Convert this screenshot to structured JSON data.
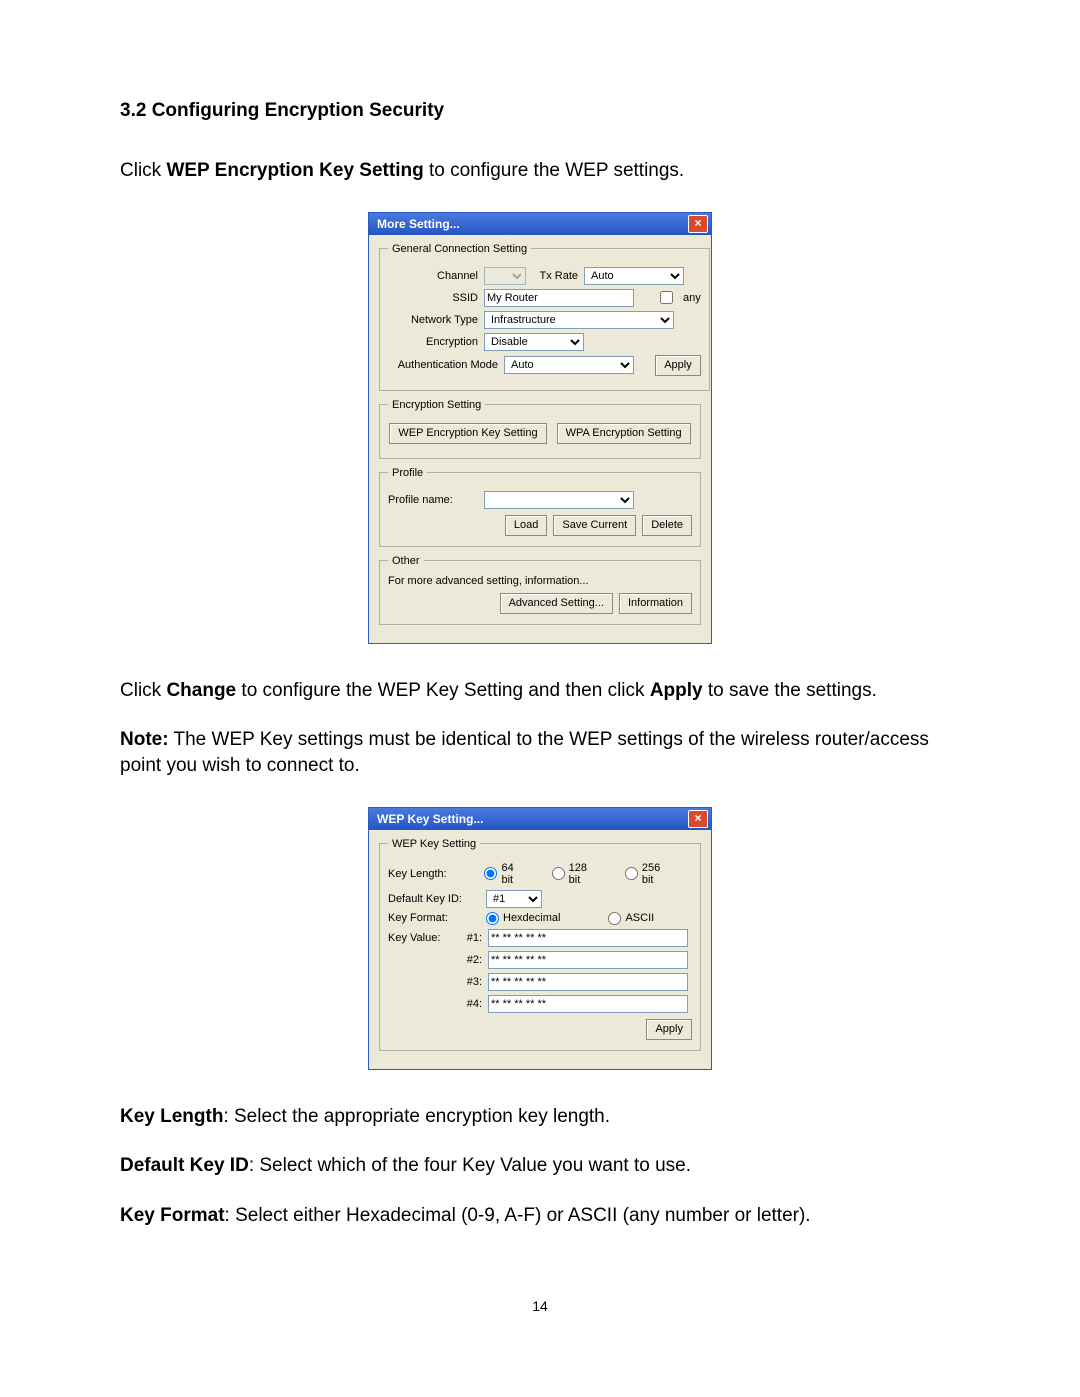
{
  "heading": "3.2 Configuring Encryption Security",
  "para1_pre": "Click ",
  "para1_bold": "WEP Encryption Key Setting",
  "para1_post": " to configure the WEP settings.",
  "dialog1": {
    "title": "More Setting...",
    "close_glyph": "×",
    "general_legend": "General Connection Setting",
    "channel_label": "Channel",
    "channel_value": "",
    "txrate_label": "Tx Rate",
    "txrate_value": "Auto",
    "ssid_label": "SSID",
    "ssid_value": "My Router",
    "any_label": "any",
    "network_type_label": "Network Type",
    "network_type_value": "Infrastructure",
    "encryption_label": "Encryption",
    "encryption_value": "Disable",
    "auth_label": "Authentication Mode",
    "auth_value": "Auto",
    "apply_label": "Apply",
    "enc_legend": "Encryption Setting",
    "wep_btn": "WEP Encryption Key Setting",
    "wpa_btn": "WPA Encryption Setting",
    "profile_legend": "Profile",
    "profile_name_label": "Profile name:",
    "profile_value": "",
    "load_btn": "Load",
    "savecur_btn": "Save Current",
    "delete_btn": "Delete",
    "other_legend": "Other",
    "other_text": "For more advanced setting, information...",
    "adv_btn": "Advanced Setting...",
    "info_btn": "Information"
  },
  "para2_a": "Click ",
  "para2_b": "Change",
  "para2_c": " to configure the WEP Key Setting and then click ",
  "para2_d": "Apply",
  "para2_e": " to save the settings.",
  "para3_a": "Note:",
  "para3_b": " The WEP Key settings must be identical to the WEP settings of the wireless router/access point you wish to connect to.",
  "dialog2": {
    "title": "WEP Key Setting...",
    "close_glyph": "×",
    "legend": "WEP Key Setting",
    "keylen_label": "Key Length:",
    "keylen_opts": [
      "64 bit",
      "128 bit",
      "256 bit"
    ],
    "keylen_selected": 0,
    "defid_label": "Default Key ID:",
    "defid_value": "#1",
    "keyfmt_label": "Key Format:",
    "keyfmt_opts": [
      "Hexdecimal",
      "ASCII"
    ],
    "keyfmt_selected": 0,
    "keyval_label": "Key Value:",
    "key_row_labels": [
      "#1:",
      "#2:",
      "#3:",
      "#4:"
    ],
    "key_values": [
      "** ** ** ** **",
      "** ** ** ** **",
      "** ** ** ** **",
      "** ** ** ** **"
    ],
    "apply_label": "Apply"
  },
  "para4_a": "Key Length",
  "para4_b": ": Select the appropriate encryption key length.",
  "para5_a": "Default Key ID",
  "para5_b": ": Select which of the four Key Value you want to use.",
  "para6_a": "Key Format",
  "para6_b": ": Select either Hexadecimal (0-9, A-F) or ASCII (any number or letter).",
  "page_number": "14"
}
